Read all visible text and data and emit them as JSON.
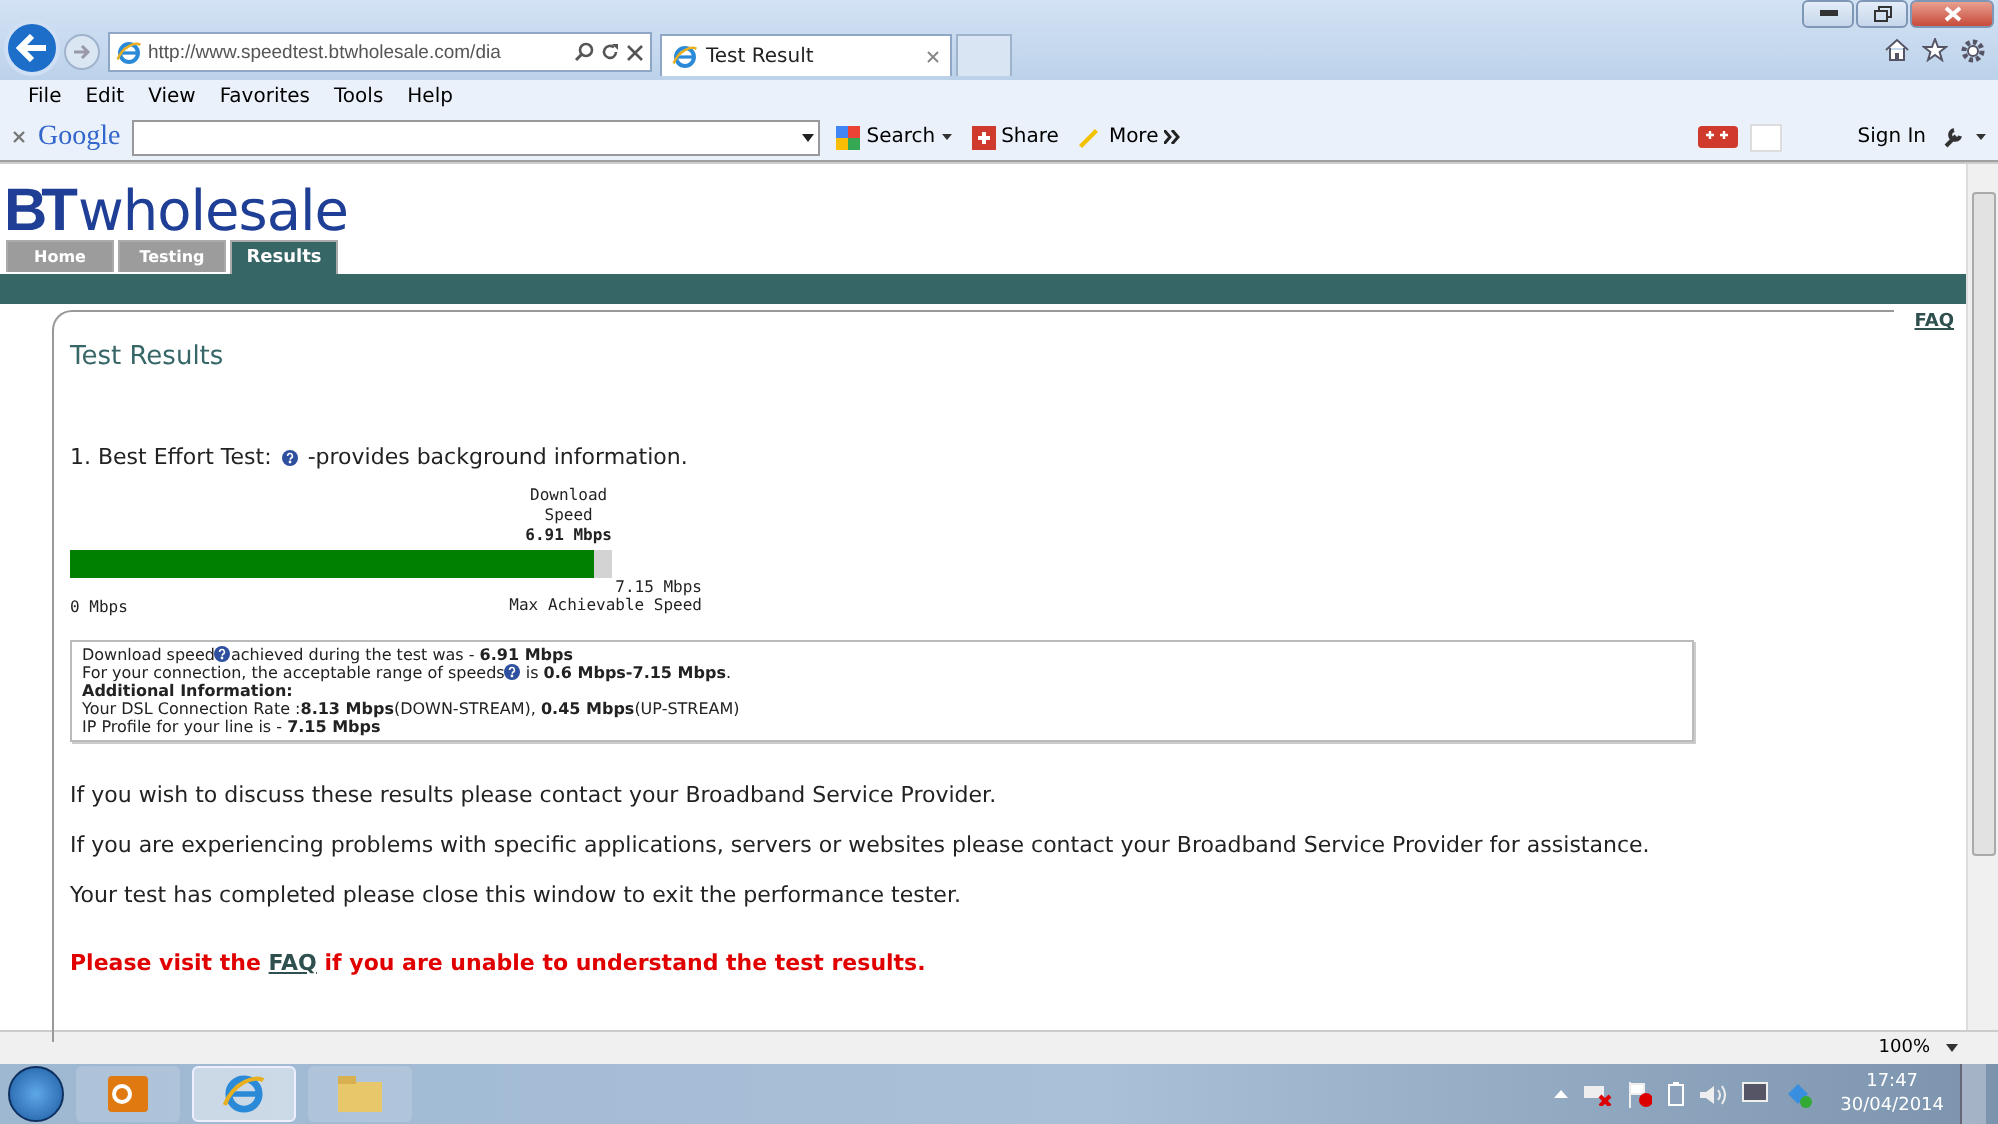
{
  "browser": {
    "address": "http://www.speedtest.btwholesale.com/dia",
    "tabs": [
      {
        "title": "Test Result",
        "selected": true
      }
    ],
    "menu": [
      "File",
      "Edit",
      "View",
      "Favorites",
      "Tools",
      "Help"
    ],
    "toolbar": {
      "logo": "Google",
      "search": "Search",
      "share": "Share",
      "more": "More",
      "sign_in": "Sign In"
    }
  },
  "page": {
    "logo": {
      "bold": "BT",
      "rest": "wholesale"
    },
    "nav_tabs": [
      {
        "label": "Home",
        "selected": false
      },
      {
        "label": "Testing",
        "selected": false
      },
      {
        "label": "Results",
        "selected": true
      }
    ],
    "faq_link": "FAQ",
    "heading": "Test Results",
    "test": {
      "label": "1. Best Effort Test:",
      "description": "-provides background information."
    },
    "meter": {
      "caption": [
        "Download",
        "Speed"
      ],
      "value": "6.91 Mbps",
      "level": 0.966,
      "min_label": "0 Mbps",
      "max_value": "7.15 Mbps",
      "max_caption": "Max Achievable Speed"
    },
    "info_lines": [
      {
        "kind": "help",
        "text": "Download speed",
        "rest": "achieved during the test was - **6.91 Mbps**"
      },
      {
        "kind": "help",
        "text": "For your connection, the acceptable range of speeds",
        "rest": " is **0.6 Mbps-7.15 Mbps**."
      },
      {
        "kind": "heading",
        "text": "Additional Information:"
      },
      {
        "kind": "plain",
        "text": "Your DSL Connection Rate :**8.13 Mbps**(DOWN-STREAM), **0.45 Mbps**(UP-STREAM)"
      },
      {
        "kind": "plain",
        "text": "IP Profile for your line is - **7.15 Mbps**"
      }
    ],
    "paragraphs": [
      "If you wish to discuss these results please contact your Broadband Service Provider.",
      "If you are experiencing problems with specific applications, servers or websites please contact your Broadband Service Provider for assistance.",
      "Your test has completed please close this window to exit the performance tester."
    ],
    "notice": {
      "before": "Please visit the",
      "link": "FAQ",
      "after": "if you are unable to understand the test results."
    }
  },
  "status_bar": {
    "zoom": "100%"
  },
  "taskbar": {
    "time": "17:47",
    "date": "30/04/2014"
  }
}
